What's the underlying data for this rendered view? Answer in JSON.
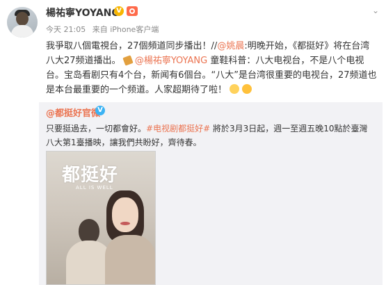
{
  "post": {
    "username": "楊祐寧YOYANG",
    "time": "今天 21:05",
    "source": "来自 iPhone客户端",
    "content": {
      "line1_a": "我爭取八個電視台，27個頻道同步播出！//",
      "mention_1": "@姚晨",
      "line1_b": ":明晚开始，《都挺好》将在台湾八大27频道播出。",
      "mention_2": "@楊祐寧YOYANG",
      "line2_b": " 童鞋科普：八大电视台，不是八个电视台。宝岛看剧只有4个台，新闻有6個台。“八大”是台湾很重要的电视台，27频道也是本台最重要的一个频道。人家超期待了啦！"
    }
  },
  "repost": {
    "account": "@都挺好官微",
    "text_1": "只要挺過去，一切都會好。",
    "tag": "#电视剧都挺好#",
    "text_2": " 將於3月3日起，週一至週五晚10點於臺灣八大第1臺播映，讓我們共盼好，齊待春。"
  },
  "poster": {
    "title": "都挺好",
    "subtitle": "ALL IS WELL"
  },
  "ui": {
    "menu_glyph": "⌄"
  }
}
